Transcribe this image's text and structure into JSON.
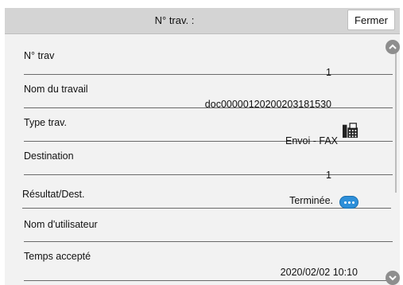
{
  "header": {
    "title": "N° trav. :",
    "close_label": "Fermer"
  },
  "rows": [
    {
      "label": "N° trav",
      "value": "1"
    },
    {
      "label": "Nom du travail",
      "value": "doc00000120200203181530"
    },
    {
      "label": "Type trav.",
      "value": "Envoi - FAX",
      "icon": "fax-icon"
    },
    {
      "label": "Destination",
      "value": "1"
    },
    {
      "label": "Résultat/Dest.",
      "value": "Terminée.",
      "icon": "more-details-icon"
    },
    {
      "label": "Nom d'utilisateur",
      "value": ""
    },
    {
      "label": "Temps accepté",
      "value": "2020/02/02 10:10"
    }
  ],
  "scroll": {
    "up_icon": "chevron-up-icon",
    "down_icon": "chevron-down-icon"
  }
}
